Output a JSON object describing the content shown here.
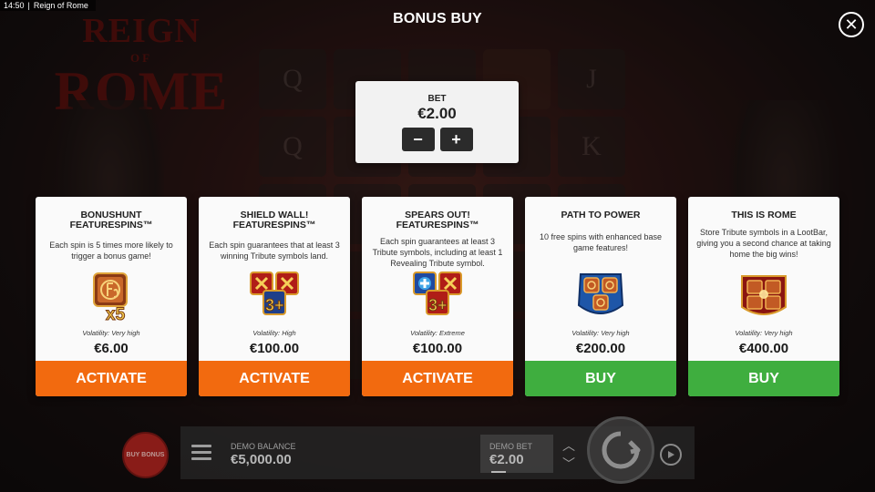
{
  "status_bar": {
    "time": "14:50",
    "separator": "|",
    "app_title": "Reign of Rome"
  },
  "scene": {
    "logo": {
      "line1": "REIGN",
      "line2": "OF",
      "line3": "ROME"
    },
    "reels": [
      [
        "Q",
        "",
        "",
        "",
        "J"
      ],
      [
        "Q",
        "",
        "",
        "",
        "K"
      ],
      [
        "",
        "",
        "",
        "",
        ""
      ],
      [
        "",
        "",
        "",
        "",
        ""
      ],
      [
        "",
        "",
        "",
        "",
        ""
      ]
    ]
  },
  "header": {
    "title": "BONUS BUY",
    "close_icon": "close-icon"
  },
  "bet_panel": {
    "label": "BET",
    "value": "€2.00",
    "minus": "−",
    "plus": "+"
  },
  "cards": [
    {
      "title": "BONUSHUNT FEATURESPINS™",
      "description": "Each spin is 5 times more likely to trigger a bonus game!",
      "icon": "bonushunt-x5-icon",
      "volatility": "Volatility: Very high",
      "price": "€6.00",
      "button": "ACTIVATE",
      "button_color": "#f26a0f"
    },
    {
      "title": "SHIELD WALL! FEATURESPINS™",
      "description": "Each spin guarantees that at least 3 winning Tribute symbols land.",
      "icon": "shield-wall-3plus-icon",
      "volatility": "Volatility: High",
      "price": "€100.00",
      "button": "ACTIVATE",
      "button_color": "#f26a0f"
    },
    {
      "title": "SPEARS OUT! FEATURESPINS™",
      "description": "Each spin guarantees at least 3 Tribute symbols, including at least 1 Revealing Tribute symbol.",
      "icon": "spears-out-3plus-icon",
      "volatility": "Volatility: Extreme",
      "price": "€100.00",
      "button": "ACTIVATE",
      "button_color": "#f26a0f"
    },
    {
      "title": "PATH TO POWER",
      "description": "10 free spins with enhanced base game features!",
      "icon": "path-to-power-shield-icon",
      "volatility": "Volatility: Very high",
      "price": "€200.00",
      "button": "BUY",
      "button_color": "#3fae3f"
    },
    {
      "title": "THIS IS ROME",
      "description": "Store Tribute symbols in a LootBar, giving you a second chance at taking home the big wins!",
      "icon": "this-is-rome-shield-icon",
      "volatility": "Volatility: Very high",
      "price": "€400.00",
      "button": "BUY",
      "button_color": "#3fae3f"
    }
  ],
  "bottom_bar": {
    "buy_bonus": "BUY BONUS",
    "balance_label": "DEMO BALANCE",
    "balance_value": "€5,000.00",
    "bet_label": "DEMO BET",
    "bet_value": "€2.00",
    "menu_icon": "menu-icon",
    "spin_icon": "spin-icon",
    "autoplay_icon": "autoplay-icon"
  }
}
